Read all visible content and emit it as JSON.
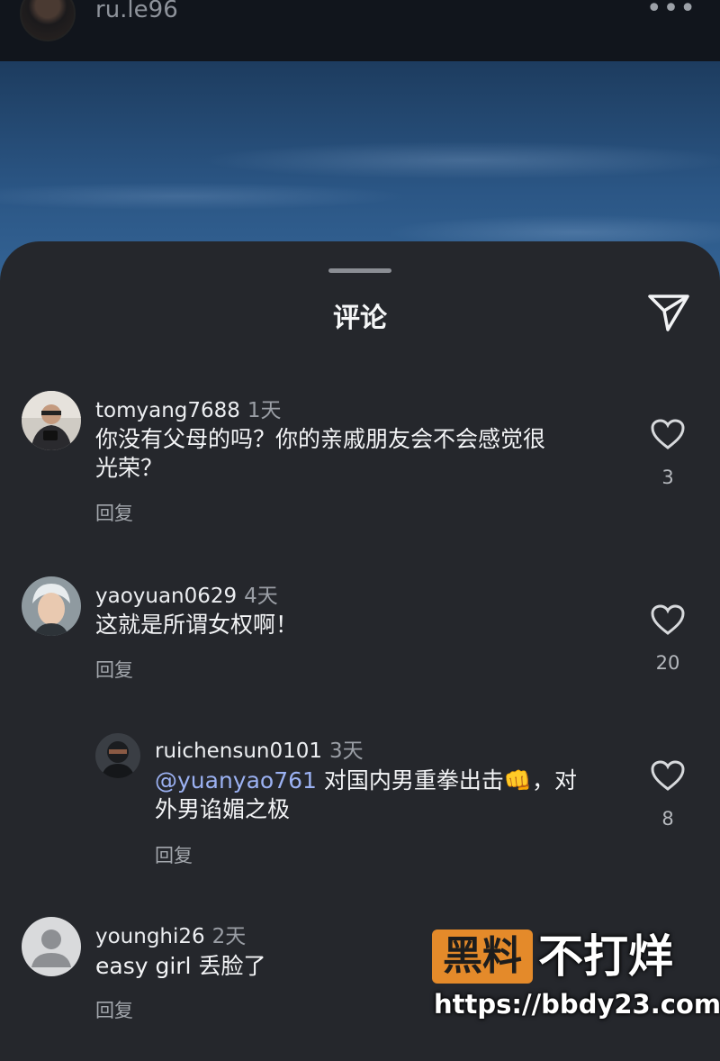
{
  "header": {
    "username": "ru.le96",
    "more": "•••"
  },
  "sheet": {
    "title": "评论"
  },
  "comments": [
    {
      "username": "tomyang7688",
      "time": "1天",
      "lines": [
        "你没有父母的吗？你的亲戚朋友会不会感觉很",
        "光荣？"
      ],
      "reply": "回复",
      "likes": "3"
    },
    {
      "username": "yaoyuan0629",
      "time": "4天",
      "lines": [
        "这就是所谓女权啊！"
      ],
      "reply": "回复",
      "likes": "20"
    },
    {
      "username": "ruichensun0101",
      "time": "3天",
      "mention": "@yuanyao761",
      "line1_rest": " 对国内男重拳出击👊，对",
      "line2": "外男谄媚之极",
      "reply": "回复",
      "likes": "8"
    },
    {
      "username": "younghi26",
      "time": "2天",
      "lines": [
        "easy girl  丢脸了"
      ],
      "reply": "回复"
    }
  ],
  "watermark": {
    "box": "黑料",
    "text": "不打烊",
    "url": "https://bbdy23.com"
  },
  "colors": {
    "sheet_bg": "#25272c",
    "mention": "#9bb1f2",
    "watermark_orange": "#e48a2a"
  }
}
